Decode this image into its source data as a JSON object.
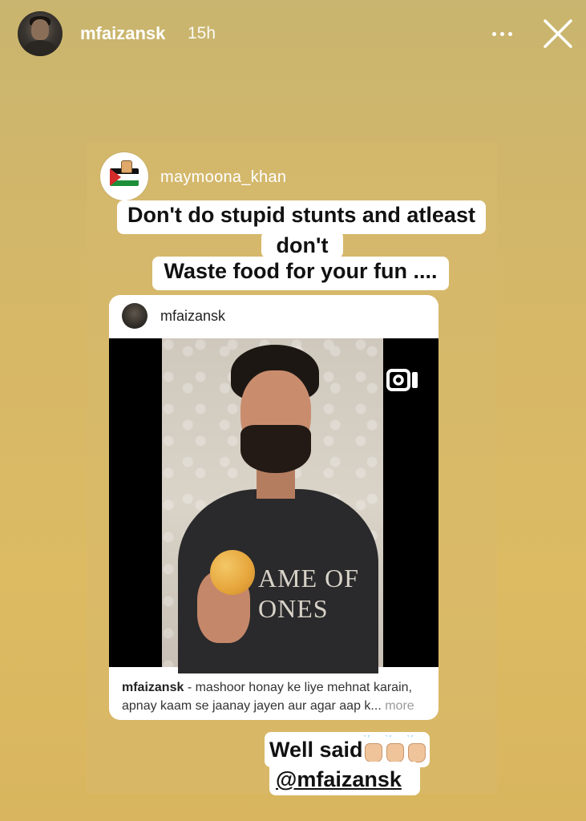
{
  "story_header": {
    "username": "mfaizansk",
    "time": "15h"
  },
  "reshared_post": {
    "username": "maymoona_khan",
    "caption_lines": [
      "Don't do stupid stunts and atleast",
      "don't",
      "Waste food for your fun ...."
    ],
    "embedded_post": {
      "username": "mfaizansk",
      "shirt_text": "AME OF\nONES",
      "caption_username": "mfaizansk",
      "caption_text": " - mashoor honay ke liye mehnat karain,\napnay kaam se jaanay jayen aur agar aap k...",
      "more_label": " more"
    }
  },
  "stickers": {
    "well_said": "Well said",
    "mention": "@mfaizansk"
  },
  "colors": {
    "background": "#d5b768",
    "sticker_bg": "#ffffff",
    "header_text": "#ffffff"
  },
  "icons": [
    "more-options-icon",
    "close-icon",
    "reel-icon",
    "raising-hands-emoji"
  ]
}
